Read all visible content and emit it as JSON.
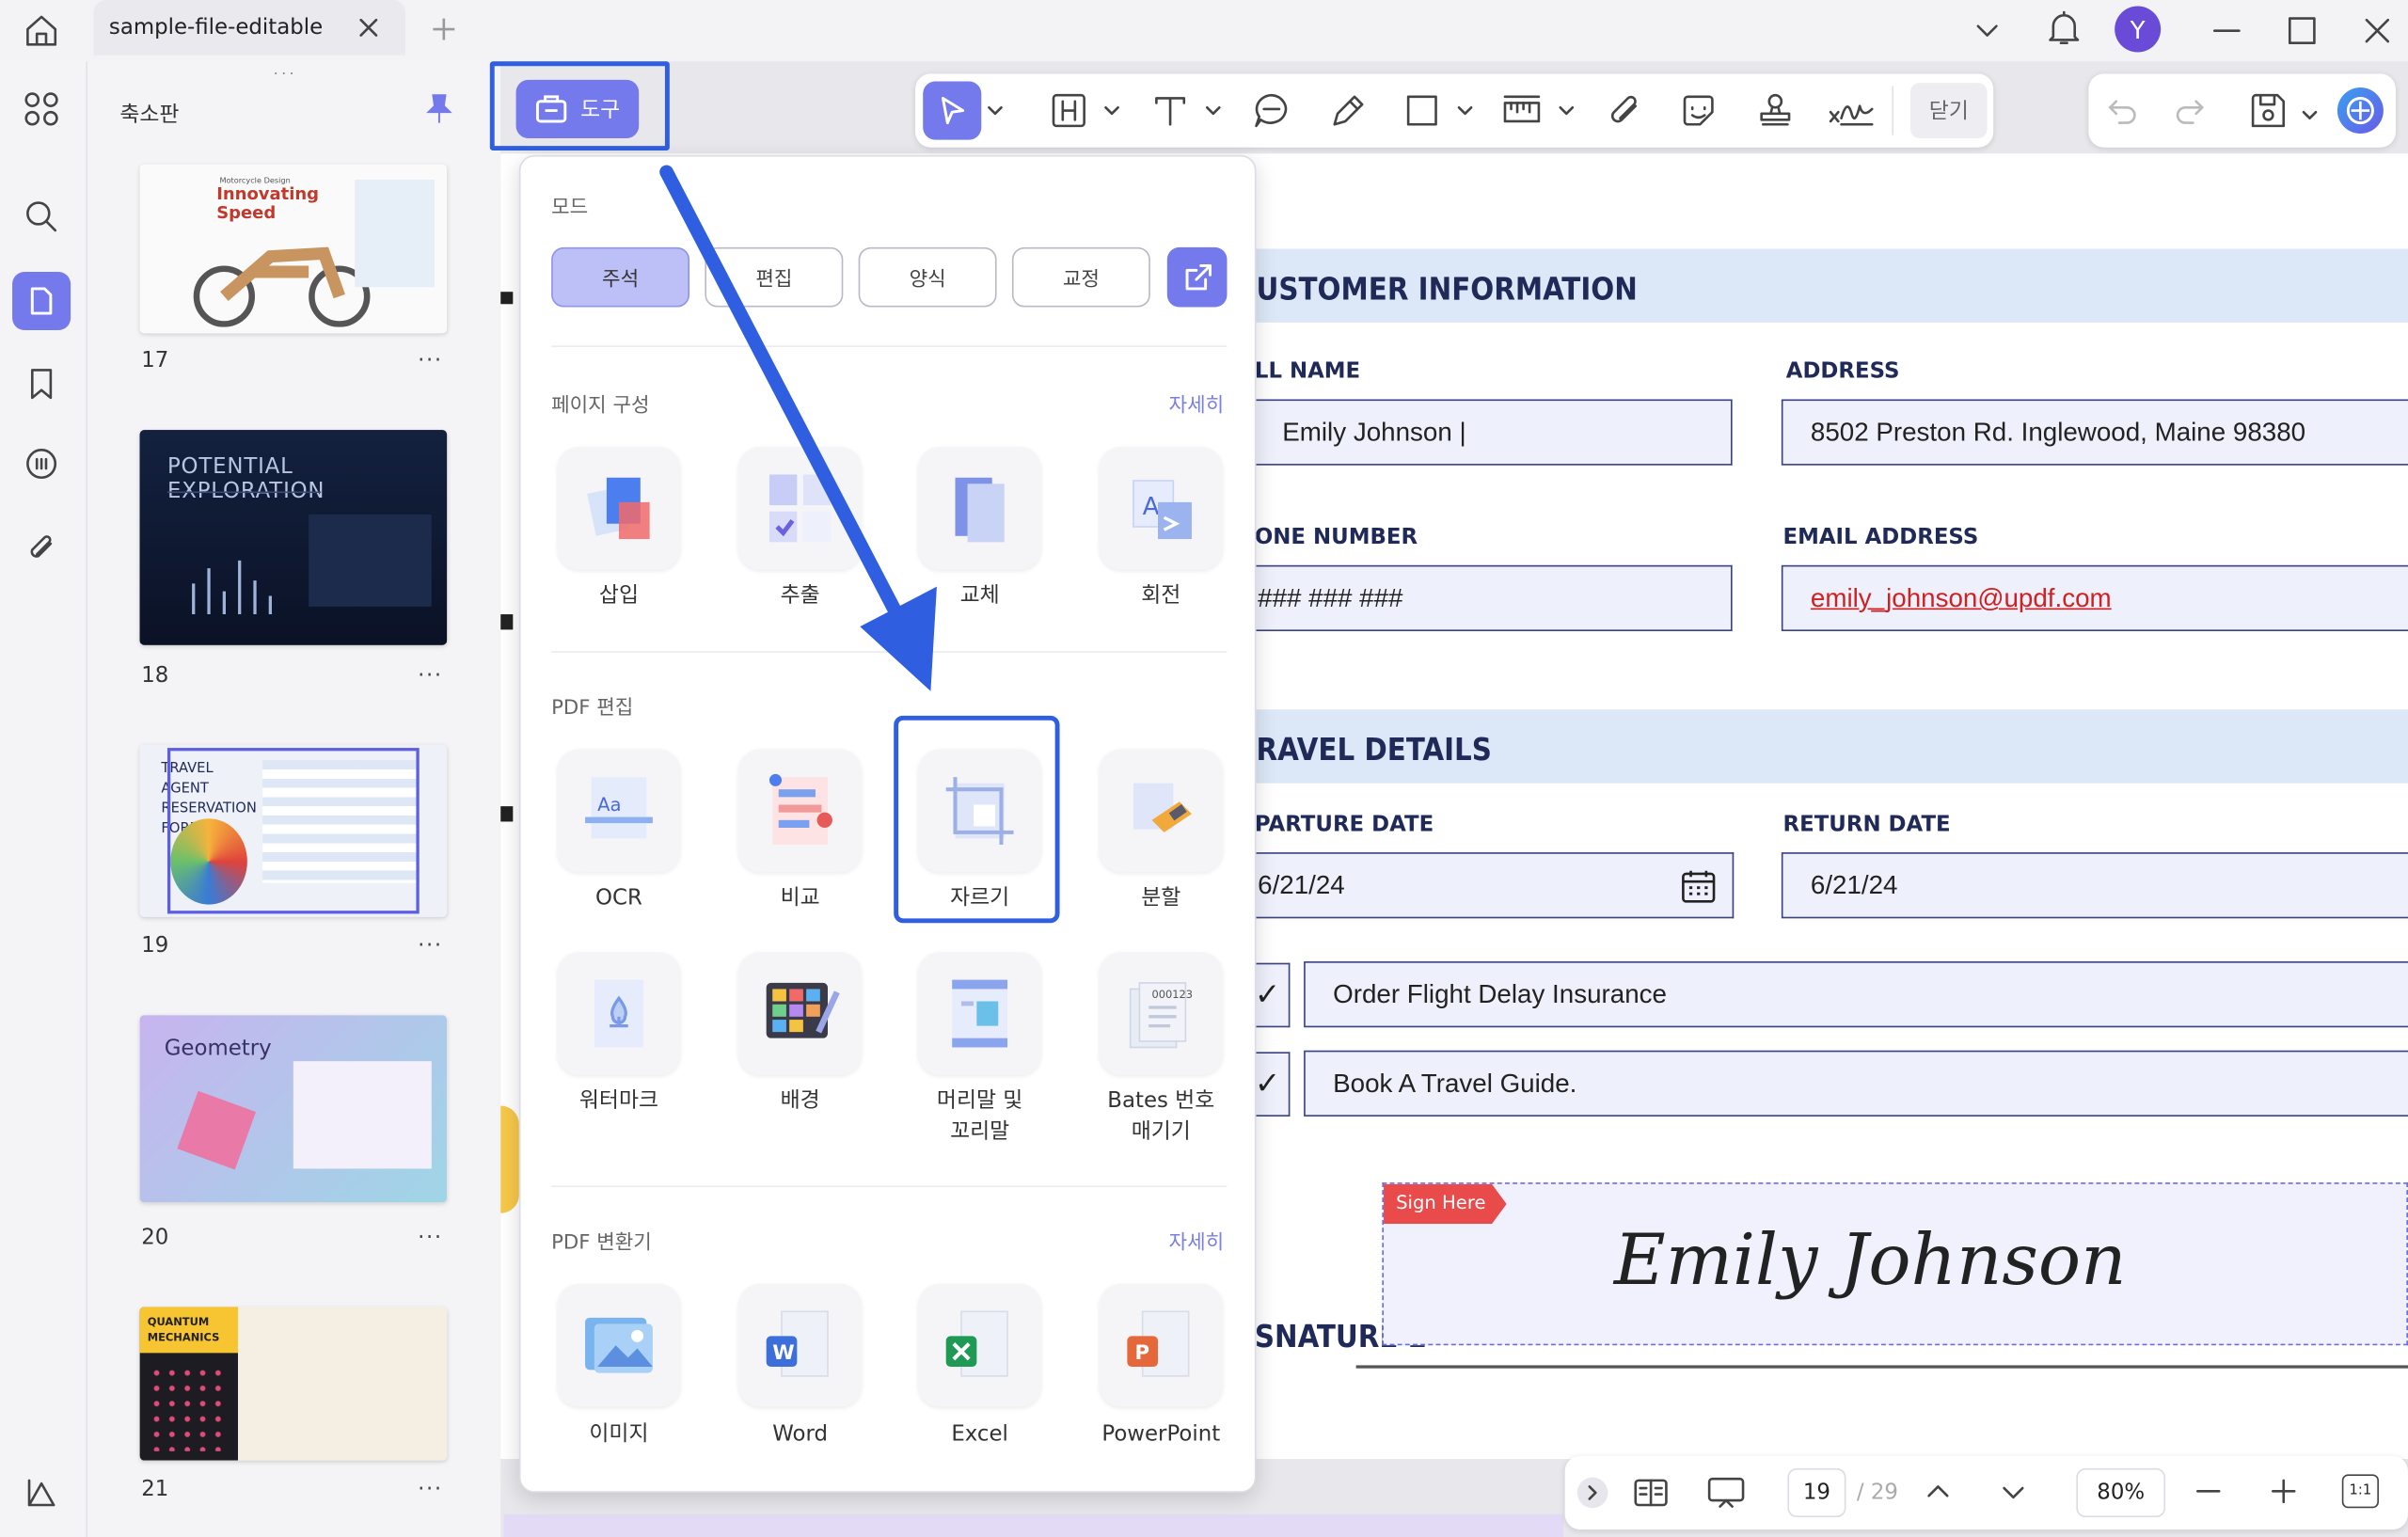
{
  "titlebar": {
    "tab_title": "sample-file-editable",
    "avatar_letter": "Y"
  },
  "thumbnails": {
    "panel_title": "축소판",
    "pages": [
      {
        "number": "17",
        "text": "Innovating Speed",
        "subtext": "Motorcycle Design"
      },
      {
        "number": "18",
        "text": "POTENTIAL EXPLORATION"
      },
      {
        "number": "19",
        "text": "TRAVEL AGENT RESERVATION FORM"
      },
      {
        "number": "20",
        "text": "Geometry"
      },
      {
        "number": "21",
        "text": "QUANTUM MECHANICS"
      }
    ],
    "more_label": "···"
  },
  "toolbar": {
    "tools_button": "도구",
    "close_label": "닫기"
  },
  "popup": {
    "mode_header": "모드",
    "modes": [
      "주석",
      "편집",
      "양식",
      "교정"
    ],
    "section1": {
      "title": "페이지 구성",
      "more": "자세히",
      "items": [
        "삽입",
        "추출",
        "교체",
        "회전"
      ]
    },
    "section2": {
      "title": "PDF 편집",
      "items": [
        "OCR",
        "비교",
        "자르기",
        "분할",
        "워터마크",
        "배경",
        "머리말 및\n꼬리말",
        "Bates 번호\n매기기"
      ]
    },
    "section3": {
      "title": "PDF 변환기",
      "more": "자세히",
      "items": [
        "이미지",
        "Word",
        "Excel",
        "PowerPoint"
      ]
    }
  },
  "document": {
    "customer_header": "USTOMER INFORMATION",
    "name_label": "LL NAME",
    "name_value": "Emily Johnson |",
    "address_label": "ADDRESS",
    "address_value": "8502 Preston Rd. Inglewood, Maine 98380",
    "phone_label": "ONE NUMBER",
    "phone_value": "### ### ###",
    "email_label": "EMAIL ADDRESS",
    "email_value": "emily_johnson@updf.com",
    "travel_header": "RAVEL DETAILS",
    "departure_label": "PARTURE DATE",
    "departure_value": "6/21/24",
    "return_label": "RETURN DATE",
    "return_value": "6/21/24",
    "check1": "Order Flight Delay Insurance",
    "check2": "Book A Travel Guide.",
    "sign_here": "Sign Here",
    "signature": "Emily Johnson",
    "signature_label": "SNATURE L"
  },
  "bottombar": {
    "current_page": "19",
    "total_pages": "/ 29",
    "zoom": "80%",
    "fit_label": "1:1"
  },
  "colors": {
    "accent": "#7479ec",
    "highlight": "#2f5fe0",
    "header_bg": "#dce8f7",
    "navy": "#1f2a58"
  }
}
